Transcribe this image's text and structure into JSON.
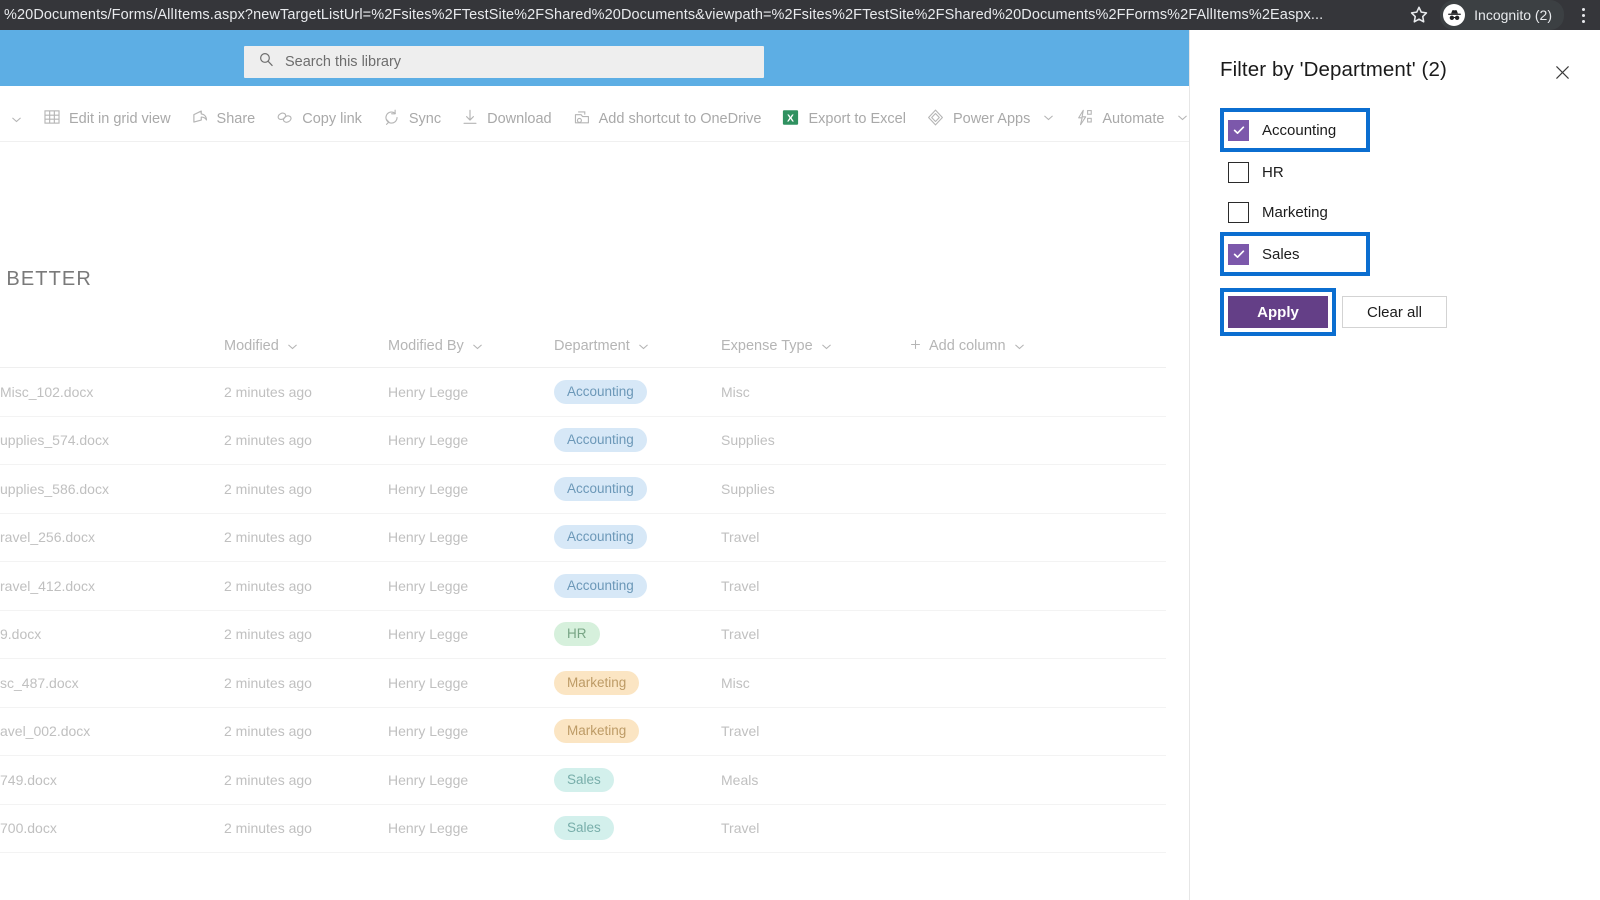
{
  "browser": {
    "url": "%20Documents/Forms/AllItems.aspx?newTargetListUrl=%2Fsites%2FTestSite%2FShared%20Documents&viewpath=%2Fsites%2FTestSite%2FShared%20Documents%2FForms%2FAllItems%2Easpx...",
    "bookmark_icon": "star-icon",
    "profile_label": "Incognito (2)",
    "profile_icon": "incognito-icon",
    "menu_icon": "kebab-menu-icon"
  },
  "suitebar": {
    "search": {
      "placeholder": "Search this library",
      "value": "",
      "icon": "search-icon"
    }
  },
  "commandbar": {
    "overflow_left_icon": "chevron-down-icon",
    "items": [
      {
        "label": "Edit in grid view",
        "icon": "grid-icon",
        "chevron": false
      },
      {
        "label": "Share",
        "icon": "share-icon",
        "chevron": false
      },
      {
        "label": "Copy link",
        "icon": "link-icon",
        "chevron": false
      },
      {
        "label": "Sync",
        "icon": "sync-icon",
        "chevron": false
      },
      {
        "label": "Download",
        "icon": "download-icon",
        "chevron": false
      },
      {
        "label": "Add shortcut to OneDrive",
        "icon": "onedrive-shortcut-icon",
        "chevron": false
      },
      {
        "label": "Export to Excel",
        "icon": "excel-icon",
        "chevron": false
      },
      {
        "label": "Power Apps",
        "icon": "powerapps-icon",
        "chevron": true
      },
      {
        "label": "Automate",
        "icon": "automate-icon",
        "chevron": true
      }
    ]
  },
  "page_title": "- BETTER",
  "table": {
    "columns": [
      {
        "label": "",
        "key": "name"
      },
      {
        "label": "Modified",
        "key": "modified"
      },
      {
        "label": "Modified By",
        "key": "modified_by"
      },
      {
        "label": "Department",
        "key": "department"
      },
      {
        "label": "Expense Type",
        "key": "expense_type"
      },
      {
        "label": "Add column",
        "key": "add_column"
      }
    ],
    "add_column_label": "Add column",
    "rows": [
      {
        "name": "Misc_102.docx",
        "modified": "2 minutes ago",
        "modified_by": "Henry Legge",
        "department": "Accounting",
        "expense_type": "Misc"
      },
      {
        "name": "upplies_574.docx",
        "modified": "2 minutes ago",
        "modified_by": "Henry Legge",
        "department": "Accounting",
        "expense_type": "Supplies"
      },
      {
        "name": "upplies_586.docx",
        "modified": "2 minutes ago",
        "modified_by": "Henry Legge",
        "department": "Accounting",
        "expense_type": "Supplies"
      },
      {
        "name": "ravel_256.docx",
        "modified": "2 minutes ago",
        "modified_by": "Henry Legge",
        "department": "Accounting",
        "expense_type": "Travel"
      },
      {
        "name": "ravel_412.docx",
        "modified": "2 minutes ago",
        "modified_by": "Henry Legge",
        "department": "Accounting",
        "expense_type": "Travel"
      },
      {
        "name": "9.docx",
        "modified": "2 minutes ago",
        "modified_by": "Henry Legge",
        "department": "HR",
        "expense_type": "Travel"
      },
      {
        "name": "sc_487.docx",
        "modified": "2 minutes ago",
        "modified_by": "Henry Legge",
        "department": "Marketing",
        "expense_type": "Misc"
      },
      {
        "name": "avel_002.docx",
        "modified": "2 minutes ago",
        "modified_by": "Henry Legge",
        "department": "Marketing",
        "expense_type": "Travel"
      },
      {
        "name": "749.docx",
        "modified": "2 minutes ago",
        "modified_by": "Henry Legge",
        "department": "Sales",
        "expense_type": "Meals"
      },
      {
        "name": "700.docx",
        "modified": "2 minutes ago",
        "modified_by": "Henry Legge",
        "department": "Sales",
        "expense_type": "Travel"
      }
    ]
  },
  "filter_panel": {
    "title": "Filter by 'Department' (2)",
    "close_icon": "close-icon",
    "options": [
      {
        "label": "Accounting",
        "checked": true,
        "highlighted": true
      },
      {
        "label": "HR",
        "checked": false,
        "highlighted": false
      },
      {
        "label": "Marketing",
        "checked": false,
        "highlighted": false
      },
      {
        "label": "Sales",
        "checked": true,
        "highlighted": true
      }
    ],
    "apply_label": "Apply",
    "clear_label": "Clear all"
  },
  "colors": {
    "suitebar": "#5daee4",
    "checkbox_checked": "#7c58ab",
    "apply_button": "#643f87",
    "highlight_outline": "#0b6ed0",
    "pill_accounting_bg": "#d7e8f7",
    "pill_hr_bg": "#d6f0dc",
    "pill_marketing_bg": "#fbe5c3",
    "pill_sales_bg": "#d3f0ec"
  }
}
